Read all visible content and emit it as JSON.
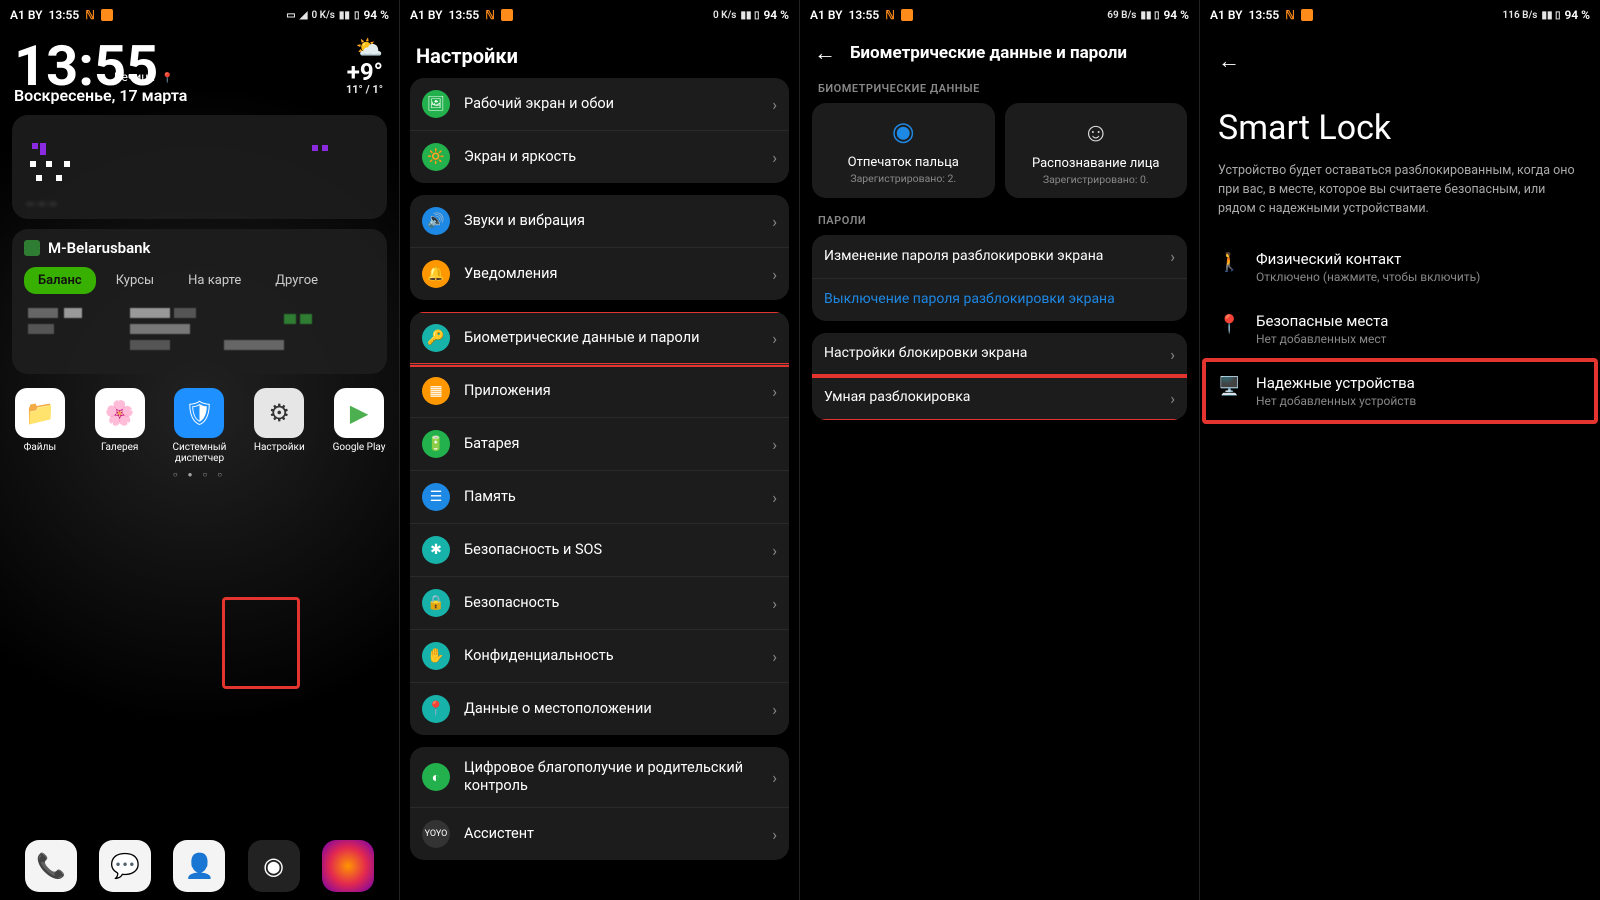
{
  "status": {
    "carrier": "A1 BY",
    "time": "13:55",
    "speeds": [
      "0 K/s",
      "0 K/s",
      "69 B/s",
      "116 B/s"
    ],
    "battery": "94 %"
  },
  "home": {
    "clock": "13:55",
    "location": "Речица",
    "date": "Воскресенье, 17 марта",
    "temp": "+9°",
    "temp_sub": "11° / 1°",
    "bank": {
      "title": "M-Belarusbank",
      "tabs": [
        "Баланс",
        "Курсы",
        "На карте",
        "Другое"
      ]
    },
    "apps": [
      {
        "label": "Файлы"
      },
      {
        "label": "Галерея"
      },
      {
        "label": "Системный диспетчер"
      },
      {
        "label": "Настройки"
      },
      {
        "label": "Google Play"
      }
    ]
  },
  "settings": {
    "title": "Настройки",
    "items": {
      "home_screen": "Рабочий экран и обои",
      "display": "Экран и яркость",
      "sound": "Звуки и вибрация",
      "notifications": "Уведомления",
      "biometrics": "Биометрические данные и пароли",
      "apps": "Приложения",
      "battery": "Батарея",
      "memory": "Память",
      "sos": "Безопасность и SOS",
      "security": "Безопасность",
      "privacy": "Конфиденциальность",
      "location": "Данные о местоположении",
      "digital": "Цифровое благополучие и родительский контроль",
      "assistant": "Ассистент"
    }
  },
  "bio": {
    "title": "Биометрические данные и пароли",
    "section1": "БИОМЕТРИЧЕСКИЕ ДАННЫЕ",
    "fingerprint": "Отпечаток пальца",
    "fingerprint_sub": "Зарегистрировано: 2.",
    "face": "Распознавание лица",
    "face_sub": "Зарегистрировано: 0.",
    "section2": "ПАРОЛИ",
    "change_pw": "Изменение пароля разблокировки экрана",
    "disable_pw": "Выключение пароля разблокировки экрана",
    "lock_settings": "Настройки блокировки экрана",
    "smart_unlock": "Умная разблокировка"
  },
  "smartlock": {
    "title": "Smart Lock",
    "desc": "Устройство будет оставаться разблокированным, когда оно при вас, в месте, которое вы считаете безопасным, или рядом с надежными устройствами.",
    "body": {
      "t": "Физический контакт",
      "s": "Отключено (нажмите, чтобы включить)"
    },
    "places": {
      "t": "Безопасные места",
      "s": "Нет добавленных мест"
    },
    "devices": {
      "t": "Надежные устройства",
      "s": "Нет добавленных устройств"
    }
  }
}
